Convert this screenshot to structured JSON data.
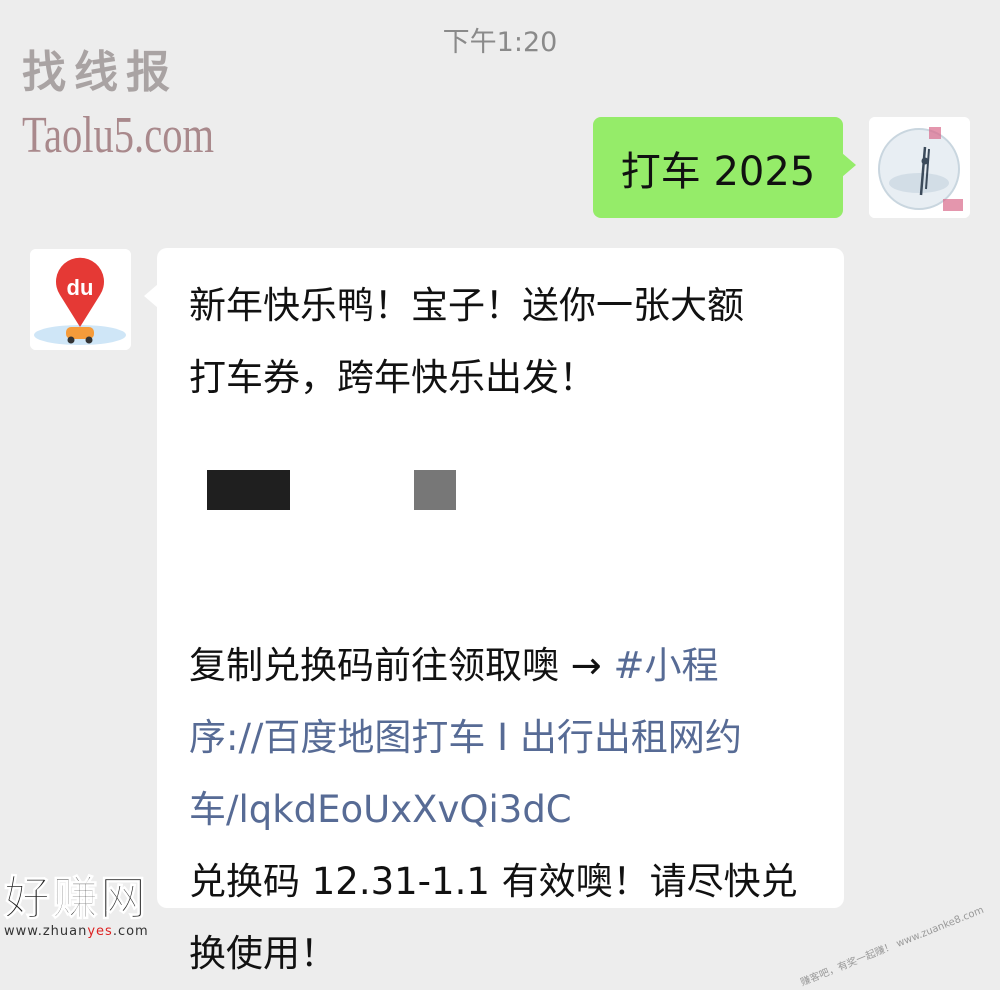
{
  "header": {
    "timestamp": "下午1:20"
  },
  "watermarks": {
    "top_left_line1": "找线报",
    "top_left_line2": "Taolu5.com",
    "bottom_left_main": "好赚网",
    "bottom_left_url_prefix": "www.zhuan",
    "bottom_left_url_highlight": "yes",
    "bottom_left_url_suffix": ".com",
    "bottom_right": "赚客吧，有奖一起赚！ www.zuanke8.com"
  },
  "messages": {
    "sent": {
      "text": "打车 2025",
      "avatar_icon": "user-avatar-icon"
    },
    "received": {
      "avatar_icon": "baidu-maps-du-icon",
      "lines": {
        "l1": "新年快乐鸭！宝子！送你一张大额",
        "l2": "打车券，跨年快乐出发！",
        "l3_text": "复制兑换码前往领取噢 → ",
        "l3_link": "#小程",
        "l4_link": "序://百度地图打车 I 出行出租网约",
        "l5_link": "车/lqkdEoUxXvQi3dC",
        "l6": "兑换码 12.31-1.1 有效噢！请尽快兑",
        "l7": "换使用！"
      }
    }
  },
  "colors": {
    "sent_bubble": "#95ec69",
    "link": "#576b95",
    "background": "#ededed",
    "baidu_red": "#e53935"
  }
}
